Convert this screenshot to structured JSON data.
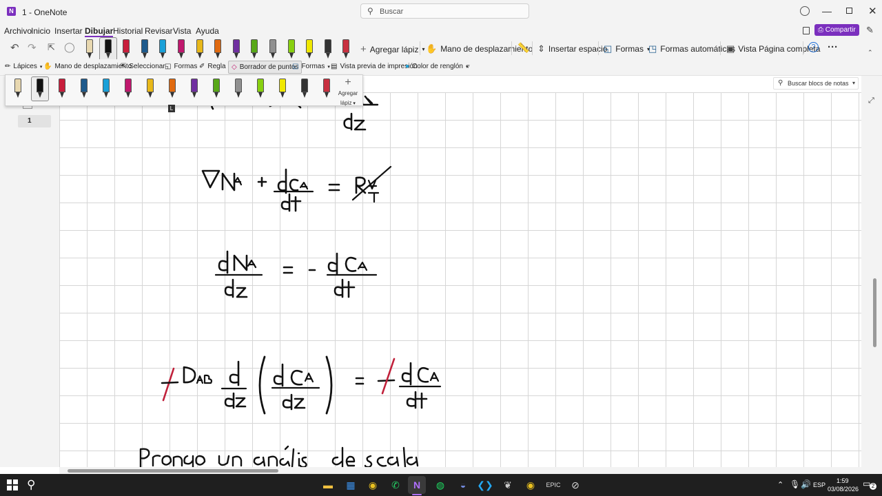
{
  "window": {
    "app_badge": "N",
    "title": "1 - OneNote",
    "search_placeholder": "Buscar",
    "share_label": "Compartir"
  },
  "menu": {
    "items": [
      "Archivo",
      "Inicio",
      "Insertar",
      "Dibujar",
      "Historial",
      "Revisar",
      "Vista",
      "Ayuda"
    ],
    "active": "Dibujar"
  },
  "ribbon": {
    "add_pen": "Agregar lápiz",
    "pan_hand": "Mano de desplazamiento",
    "insert_space": "Insertar espacio",
    "shapes": "Formas",
    "auto_shapes": "Formas automáticas",
    "full_page_view": "Vista Página completa",
    "more": "···"
  },
  "ribbon2": {
    "pens": "Lápices",
    "pan_hand": "Mano de desplazamiento",
    "select": "Seleccionar",
    "shapes": "Formas",
    "ruler": "Regla",
    "point_eraser": "Borrador de puntos",
    "shapes2": "Formas",
    "print_preview": "Vista previa de impresión",
    "line_color": "Color de renglón"
  },
  "pen_gallery": {
    "add_pen_line1": "Agregar",
    "add_pen_line2": "lápiz",
    "shortcut_key": "L",
    "colors": [
      "#e8d8b0",
      "#111111",
      "#c81e3c",
      "#1e5a8c",
      "#1aa0d8",
      "#c0186e",
      "#e8b81a",
      "#e06a10",
      "#7030a0",
      "#58a818",
      "#909090",
      "#88d010",
      "#f0e800",
      "#333333",
      "#c83040"
    ]
  },
  "notebook": {
    "search_placeholder": "Buscar blocs de notas",
    "page_label": "1"
  },
  "taskbar": {
    "language": "ESP",
    "time": "1:59",
    "date": "03/08/2026",
    "notifications": "2"
  }
}
